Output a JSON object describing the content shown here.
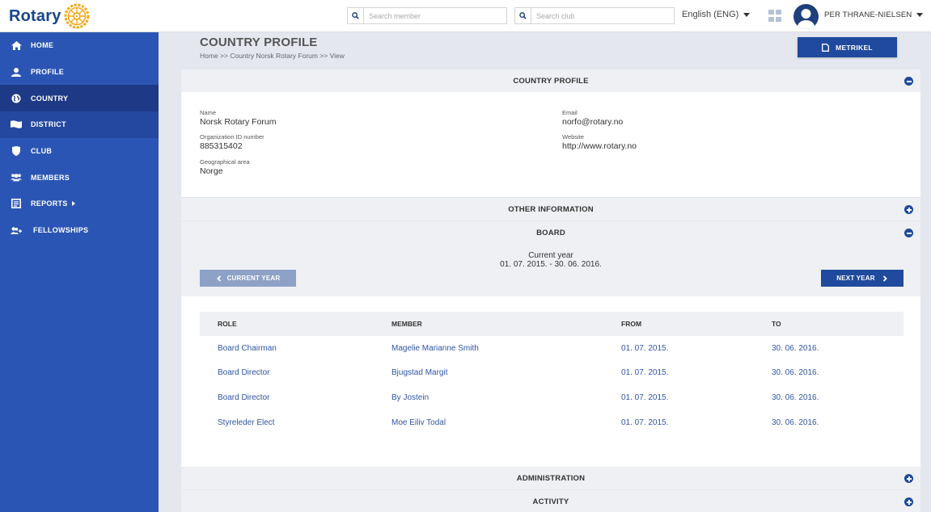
{
  "header": {
    "logo_text": "Rotary",
    "search_member_placeholder": "Search member",
    "search_club_placeholder": "Search club",
    "language": "English (ENG)",
    "user_name": "PER THRANE-NIELSEN",
    "brand_colors": {
      "navy": "#17458f",
      "gold": "#f7a81b"
    }
  },
  "sidebar": {
    "items": [
      {
        "label": "HOME",
        "icon": "home-icon"
      },
      {
        "label": "PROFILE",
        "icon": "user-icon"
      },
      {
        "label": "COUNTRY",
        "icon": "globe-icon"
      },
      {
        "label": "DISTRICT",
        "icon": "flag-icon"
      },
      {
        "label": "CLUB",
        "icon": "shield-icon"
      },
      {
        "label": "MEMBERS",
        "icon": "users-icon"
      },
      {
        "label": "REPORTS",
        "icon": "report-icon"
      },
      {
        "label": "FELLOWSHIPS",
        "icon": "user-plus-icon"
      }
    ],
    "active": "COUNTRY"
  },
  "page": {
    "title": "COUNTRY PROFILE",
    "breadcrumb": "Home >> Country Norsk Rotary Forum >> View",
    "metrikel_button": "METRIKEL"
  },
  "profile": {
    "section_title": "COUNTRY PROFILE",
    "name_label": "Name",
    "name_value": "Norsk Rotary Forum",
    "org_label": "Organization ID number",
    "org_value": "885315402",
    "geo_label": "Geographical area",
    "geo_value": "Norge",
    "email_label": "Email",
    "email_value": "norfo@rotary.no",
    "website_label": "Website",
    "website_value": "http://www.rotary.no"
  },
  "sections": {
    "other_information": "OTHER INFORMATION",
    "board": "BOARD",
    "administration": "ADMINISTRATION",
    "activity": "ACTIVITY"
  },
  "board": {
    "period_title": "Current year",
    "period_range": "01. 07. 2015. - 30. 06. 2016.",
    "prev_button": "CURRENT YEAR",
    "next_button": "NEXT YEAR",
    "columns": [
      "ROLE",
      "MEMBER",
      "FROM",
      "TO"
    ],
    "rows": [
      {
        "role": "Board Chairman",
        "member": "Magelie Marianne Smith",
        "from": "01. 07. 2015.",
        "to": "30. 06. 2016."
      },
      {
        "role": "Board Director",
        "member": "Bjugstad Margit",
        "from": "01. 07. 2015.",
        "to": "30. 06. 2016."
      },
      {
        "role": "Board Director",
        "member": "By Jostein",
        "from": "01. 07. 2015.",
        "to": "30. 06. 2016."
      },
      {
        "role": "Styreleder Elect",
        "member": "Moe Eiliv Todal",
        "from": "01. 07. 2015.",
        "to": "30. 06. 2016."
      }
    ]
  }
}
